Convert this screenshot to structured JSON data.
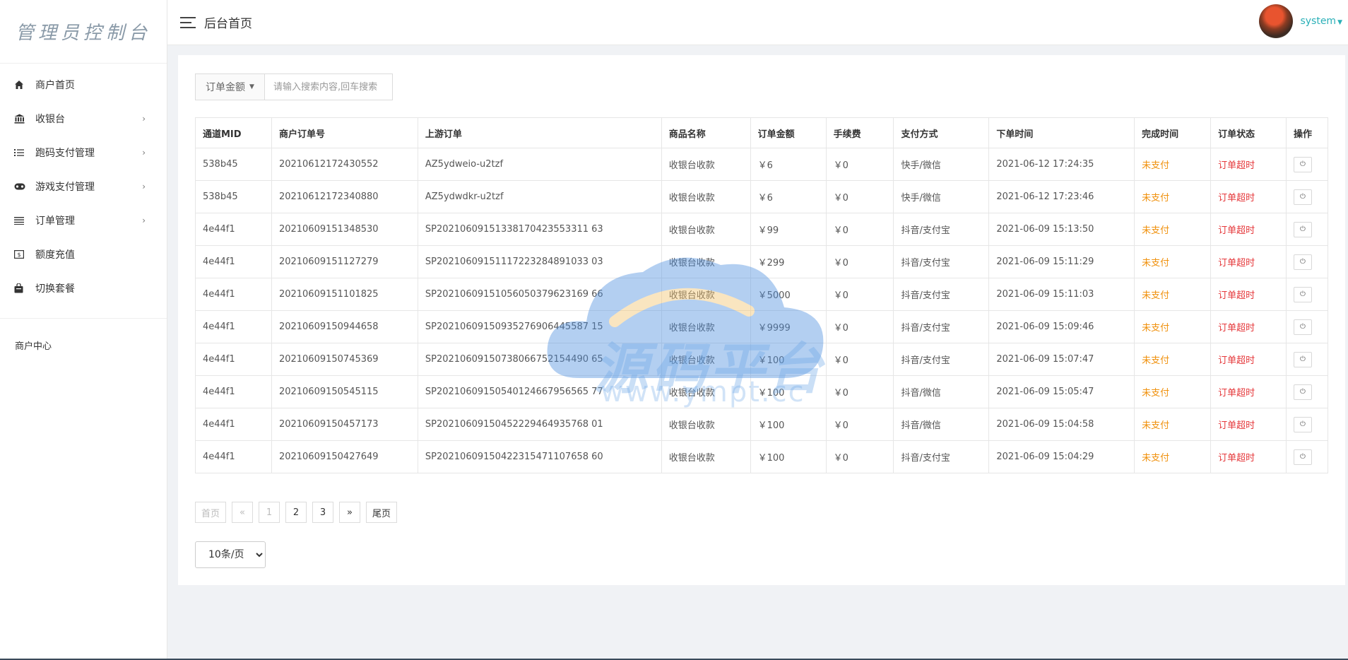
{
  "sidebar": {
    "brand": "管理员控制台",
    "items": [
      {
        "label": "商户首页",
        "icon": "home-icon",
        "has_children": false
      },
      {
        "label": "收银台",
        "icon": "bank-icon",
        "has_children": true
      },
      {
        "label": "跑码支付管理",
        "icon": "list-icon",
        "has_children": true
      },
      {
        "label": "游戏支付管理",
        "icon": "gamepad-icon",
        "has_children": true
      },
      {
        "label": "订单管理",
        "icon": "menu-lines-icon",
        "has_children": true
      },
      {
        "label": "额度充值",
        "icon": "money-icon",
        "has_children": false
      },
      {
        "label": "切换套餐",
        "icon": "bag-icon",
        "has_children": false
      }
    ],
    "section_label": "商户中心"
  },
  "header": {
    "title": "后台首页",
    "username": "system"
  },
  "search": {
    "field_label": "订单金额",
    "placeholder": "请输入搜索内容,回车搜索"
  },
  "table": {
    "headers": [
      "通道MID",
      "商户订单号",
      "上游订单",
      "商品名称",
      "订单金额",
      "手续费",
      "支付方式",
      "下单时间",
      "完成时间",
      "订单状态",
      "操作"
    ],
    "rows": [
      [
        "538b45",
        "20210612172430552",
        "AZ5ydweio-u2tzf",
        "收银台收款",
        "￥6",
        "￥0",
        "快手/微信",
        "2021-06-12 17:24:35",
        "未支付",
        "订单超时"
      ],
      [
        "538b45",
        "20210612172340880",
        "AZ5ydwdkr-u2tzf",
        "收银台收款",
        "￥6",
        "￥0",
        "快手/微信",
        "2021-06-12 17:23:46",
        "未支付",
        "订单超时"
      ],
      [
        "4e44f1",
        "20210609151348530",
        "SP20210609151338170423553311 63",
        "收银台收款",
        "￥99",
        "￥0",
        "抖音/支付宝",
        "2021-06-09 15:13:50",
        "未支付",
        "订单超时"
      ],
      [
        "4e44f1",
        "20210609151127279",
        "SP20210609151117223284891033 03",
        "收银台收款",
        "￥299",
        "￥0",
        "抖音/支付宝",
        "2021-06-09 15:11:29",
        "未支付",
        "订单超时"
      ],
      [
        "4e44f1",
        "20210609151101825",
        "SP20210609151056050379623169 66",
        "收银台收款",
        "￥5000",
        "￥0",
        "抖音/支付宝",
        "2021-06-09 15:11:03",
        "未支付",
        "订单超时"
      ],
      [
        "4e44f1",
        "20210609150944658",
        "SP20210609150935276906445587 15",
        "收银台收款",
        "￥9999",
        "￥0",
        "抖音/支付宝",
        "2021-06-09 15:09:46",
        "未支付",
        "订单超时"
      ],
      [
        "4e44f1",
        "20210609150745369",
        "SP20210609150738066752154490 65",
        "收银台收款",
        "￥100",
        "￥0",
        "抖音/支付宝",
        "2021-06-09 15:07:47",
        "未支付",
        "订单超时"
      ],
      [
        "4e44f1",
        "20210609150545115",
        "SP20210609150540124667956565 77",
        "收银台收款",
        "￥100",
        "￥0",
        "抖音/微信",
        "2021-06-09 15:05:47",
        "未支付",
        "订单超时"
      ],
      [
        "4e44f1",
        "20210609150457173",
        "SP20210609150452229464935768 01",
        "收银台收款",
        "￥100",
        "￥0",
        "抖音/微信",
        "2021-06-09 15:04:58",
        "未支付",
        "订单超时"
      ],
      [
        "4e44f1",
        "20210609150427649",
        "SP20210609150422315471107658 60",
        "收银台收款",
        "￥100",
        "￥0",
        "抖音/支付宝",
        "2021-06-09 15:04:29",
        "未支付",
        "订单超时"
      ]
    ]
  },
  "pagination": {
    "first": "首页",
    "prev": "«",
    "pages": [
      "1",
      "2",
      "3"
    ],
    "next": "»",
    "last": "尾页"
  },
  "per_page": {
    "selected": "10条/页",
    "options": [
      "10条/页"
    ]
  },
  "watermark": {
    "title": "源码平台",
    "url": "www.ympt.cc"
  },
  "colors": {
    "accent": "#2bb0b8",
    "status_unpaid": "#f0900b",
    "status_timeout": "#e5383b"
  }
}
